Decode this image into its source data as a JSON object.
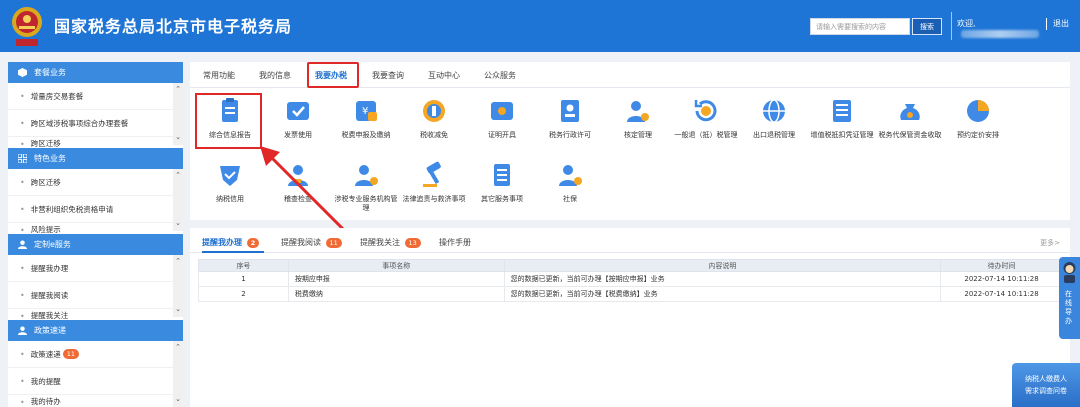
{
  "header": {
    "title": "国家税务总局北京市电子税务局",
    "search_placeholder": "请输入需要搜索的内容",
    "search_button": "搜索",
    "welcome": "欢迎,",
    "logout": "退出",
    "colors": {
      "bg": "#1e75d6",
      "accent_red": "#e02828"
    }
  },
  "sidebar": {
    "sections": [
      {
        "title": "套餐业务",
        "icon": "box-icon",
        "items": [
          {
            "label": "增量房交易套餐"
          },
          {
            "label": "跨区域涉税事项综合办理套餐"
          },
          {
            "label": "跨区迁移"
          }
        ]
      },
      {
        "title": "特色业务",
        "icon": "grid-icon",
        "items": [
          {
            "label": "跨区迁移"
          },
          {
            "label": "非营利组织免税资格申请"
          },
          {
            "label": "风险提示"
          }
        ]
      },
      {
        "title": "定制e服务",
        "icon": "user-icon",
        "items": [
          {
            "label": "提醒我办理"
          },
          {
            "label": "提醒我阅读"
          },
          {
            "label": "提醒我关注"
          }
        ]
      },
      {
        "title": "政策速递",
        "icon": "user-icon",
        "items": [
          {
            "label": "政策速递",
            "badge": "11"
          },
          {
            "label": "我的提醒"
          },
          {
            "label": "我的待办"
          }
        ]
      }
    ]
  },
  "top_tabs": [
    "常用功能",
    "我的信息",
    "我要办税",
    "我要查询",
    "互动中心",
    "公众服务"
  ],
  "active_tab": "我要办税",
  "functions": [
    {
      "label": "综合信息报告",
      "icon": "document-icon"
    },
    {
      "label": "发票使用",
      "icon": "invoice-icon"
    },
    {
      "label": "税费申报及缴纳",
      "icon": "tax-declare-icon"
    },
    {
      "label": "税收减免",
      "icon": "coin-icon"
    },
    {
      "label": "证明开具",
      "icon": "certificate-icon"
    },
    {
      "label": "税务行政许可",
      "icon": "permit-icon"
    },
    {
      "label": "核定管理",
      "icon": "person-gear-icon"
    },
    {
      "label": "一般退（抵）税管理",
      "icon": "refund-icon"
    },
    {
      "label": "出口退税管理",
      "icon": "globe-icon"
    },
    {
      "label": "增值税抵扣凭证管理",
      "icon": "ledger-icon"
    },
    {
      "label": "税务代保管资金收取",
      "icon": "money-bag-icon"
    },
    {
      "label": "预约定价安排",
      "icon": "chart-icon"
    },
    {
      "label": "纳税信用",
      "icon": "shield-icon"
    },
    {
      "label": "稽查检查",
      "icon": "inspector-icon"
    },
    {
      "label": "涉税专业服务机构管理",
      "icon": "agency-icon"
    },
    {
      "label": "法律追责与救济事项",
      "icon": "gavel-icon"
    },
    {
      "label": "其它服务事项",
      "icon": "list-icon"
    },
    {
      "label": "社保",
      "icon": "social-icon"
    }
  ],
  "bottom_tabs": [
    {
      "label": "提醒我办理",
      "badge": "2"
    },
    {
      "label": "提醒我阅读",
      "badge": "11"
    },
    {
      "label": "提醒我关注",
      "badge": "13"
    },
    {
      "label": "操作手册",
      "badge": ""
    }
  ],
  "more_label": "更多>",
  "table": {
    "headers": [
      "序号",
      "事项名称",
      "内容说明",
      "待办时间"
    ],
    "rows": [
      [
        "1",
        "按期应申报",
        "您的数据已更新，当前可办理【按期应申报】业务",
        "2022-07-14 10:11:28"
      ],
      [
        "2",
        "税费缴纳",
        "您的数据已更新，当前可办理【税费缴纳】业务",
        "2022-07-14 10:11:28"
      ]
    ]
  },
  "float_help": "在线导办",
  "survey": {
    "line1": "纳税人缴费人",
    "line2": "需求调查问卷"
  }
}
